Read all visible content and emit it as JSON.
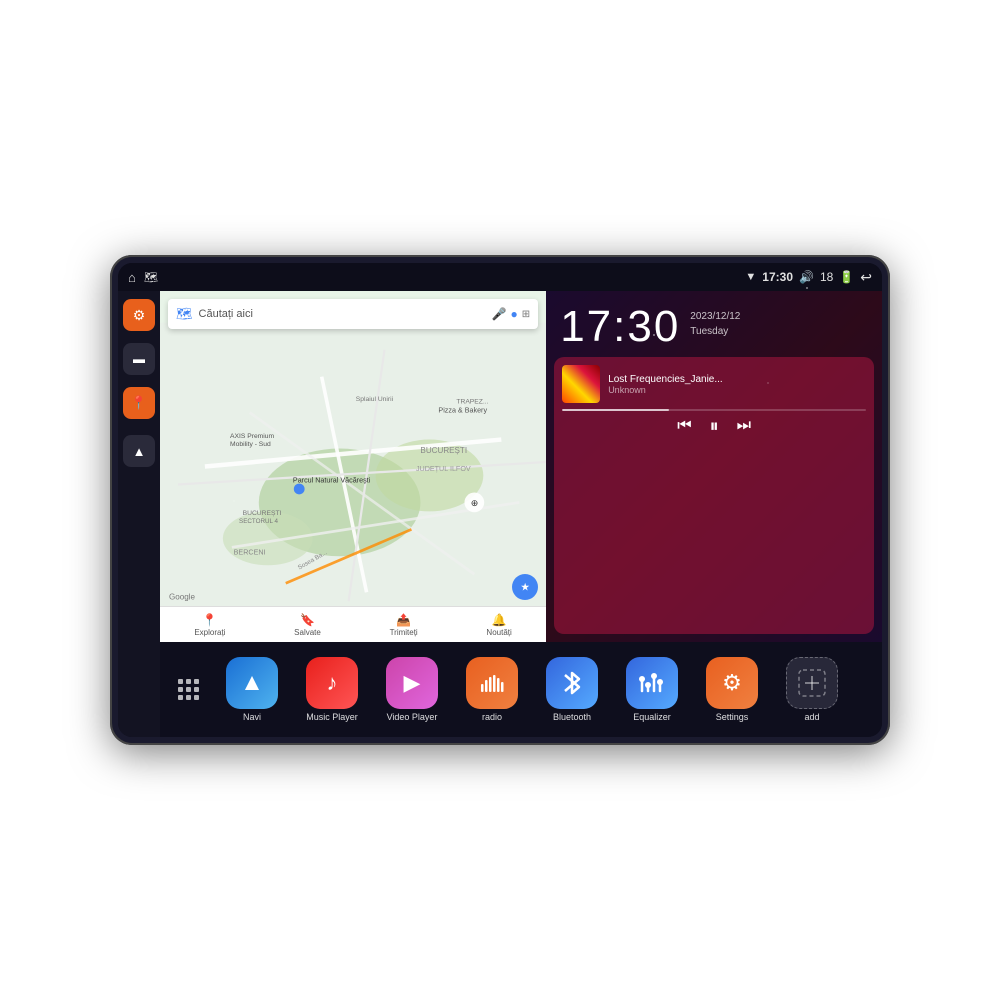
{
  "device": {
    "status_bar": {
      "left_icons": [
        "home",
        "maps"
      ],
      "time": "17:30",
      "right_icons": [
        "wifi",
        "volume",
        "18",
        "battery",
        "back"
      ]
    },
    "clock": {
      "time": "17:30",
      "date": "2023/12/12",
      "day": "Tuesday"
    },
    "music": {
      "title": "Lost Frequencies_Janie...",
      "artist": "Unknown",
      "progress": 35
    },
    "map": {
      "search_placeholder": "Căutați aici",
      "bottom_items": [
        {
          "label": "Explorați",
          "icon": "📍"
        },
        {
          "label": "Salvate",
          "icon": "🔖"
        },
        {
          "label": "Trimiteți",
          "icon": "📤"
        },
        {
          "label": "Noutăți",
          "icon": "🔔"
        }
      ]
    },
    "apps": [
      {
        "id": "navi",
        "label": "Navi",
        "icon": "▲",
        "color_class": "icon-navi"
      },
      {
        "id": "music-player",
        "label": "Music Player",
        "icon": "♪",
        "color_class": "icon-music"
      },
      {
        "id": "video-player",
        "label": "Video Player",
        "icon": "▶",
        "color_class": "icon-video"
      },
      {
        "id": "radio",
        "label": "radio",
        "icon": "📻",
        "color_class": "icon-radio"
      },
      {
        "id": "bluetooth",
        "label": "Bluetooth",
        "icon": "⚡",
        "color_class": "icon-bt"
      },
      {
        "id": "equalizer",
        "label": "Equalizer",
        "icon": "🎚",
        "color_class": "icon-eq"
      },
      {
        "id": "settings",
        "label": "Settings",
        "icon": "⚙",
        "color_class": "icon-settings"
      },
      {
        "id": "add",
        "label": "add",
        "icon": "+",
        "color_class": "icon-add"
      }
    ],
    "sidebar": [
      {
        "id": "settings-side",
        "icon": "⚙",
        "type": "orange"
      },
      {
        "id": "folder",
        "icon": "▬",
        "type": "dark"
      },
      {
        "id": "maps-side",
        "icon": "📍",
        "type": "orange"
      },
      {
        "id": "navi-side",
        "icon": "▲",
        "type": "dark"
      }
    ]
  }
}
